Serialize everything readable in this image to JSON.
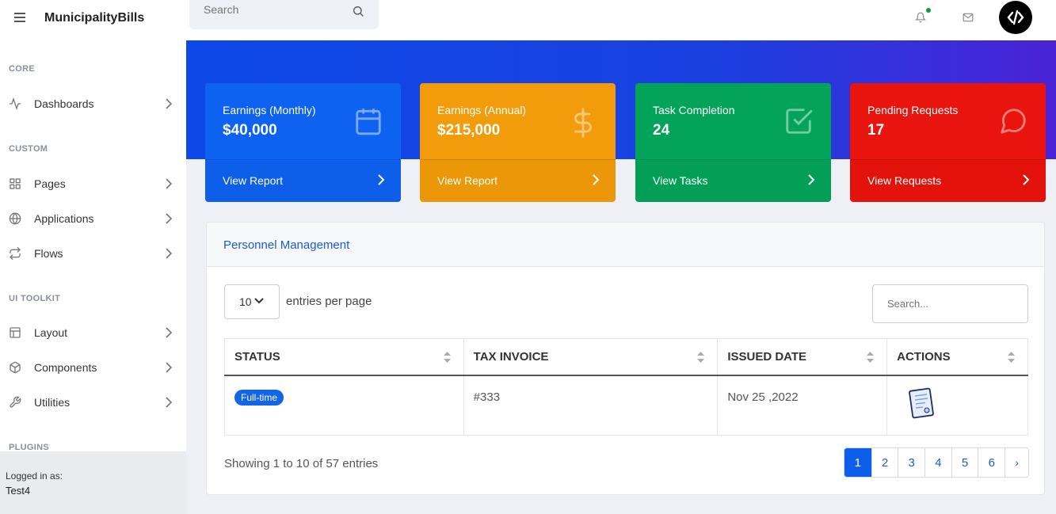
{
  "app": {
    "title": "MunicipalityBills"
  },
  "topbar": {
    "search_placeholder": "Search"
  },
  "sidebar": {
    "sections": [
      {
        "heading": "CORE"
      },
      {
        "heading": "CUSTOM"
      },
      {
        "heading": "UI TOOLKIT"
      },
      {
        "heading": "PLUGINS"
      }
    ],
    "items": [
      {
        "label": "Dashboards",
        "icon": "activity-icon"
      },
      {
        "label": "Pages",
        "icon": "grid-icon"
      },
      {
        "label": "Applications",
        "icon": "globe-icon"
      },
      {
        "label": "Flows",
        "icon": "repeat-icon"
      },
      {
        "label": "Layout",
        "icon": "layout-icon"
      },
      {
        "label": "Components",
        "icon": "package-icon"
      },
      {
        "label": "Utilities",
        "icon": "tool-icon"
      }
    ],
    "footer": {
      "label": "Logged in as:",
      "user": "Test4"
    }
  },
  "cards": [
    {
      "title": "Earnings (Monthly)",
      "value": "$40,000",
      "link": "View Report",
      "color": "#0d62f1",
      "icon": "calendar-icon"
    },
    {
      "title": "Earnings (Annual)",
      "value": "$215,000",
      "link": "View Report",
      "color": "#f39c0b",
      "icon": "dollar-icon"
    },
    {
      "title": "Task Completion",
      "value": "24",
      "link": "View Tasks",
      "color": "#03a45a",
      "icon": "check-square-icon"
    },
    {
      "title": "Pending Requests",
      "value": "17",
      "link": "View Requests",
      "color": "#e8140d",
      "icon": "message-circle-icon"
    }
  ],
  "panel": {
    "title": "Personnel Management",
    "entries_value": "10",
    "entries_label": "entries per page",
    "search_placeholder": "Search...",
    "columns": [
      "STATUS",
      "TAX INVOICE",
      "ISSUED DATE",
      "ACTIONS"
    ],
    "rows": [
      {
        "status": "Full-time",
        "invoice": "#333",
        "date": "Nov 25 ,2022",
        "action_icon": "document-icon"
      }
    ],
    "showing": "Showing 1 to 10 of 57 entries",
    "pages": [
      "1",
      "2",
      "3",
      "4",
      "5",
      "6",
      "›"
    ],
    "active_page": "1"
  }
}
